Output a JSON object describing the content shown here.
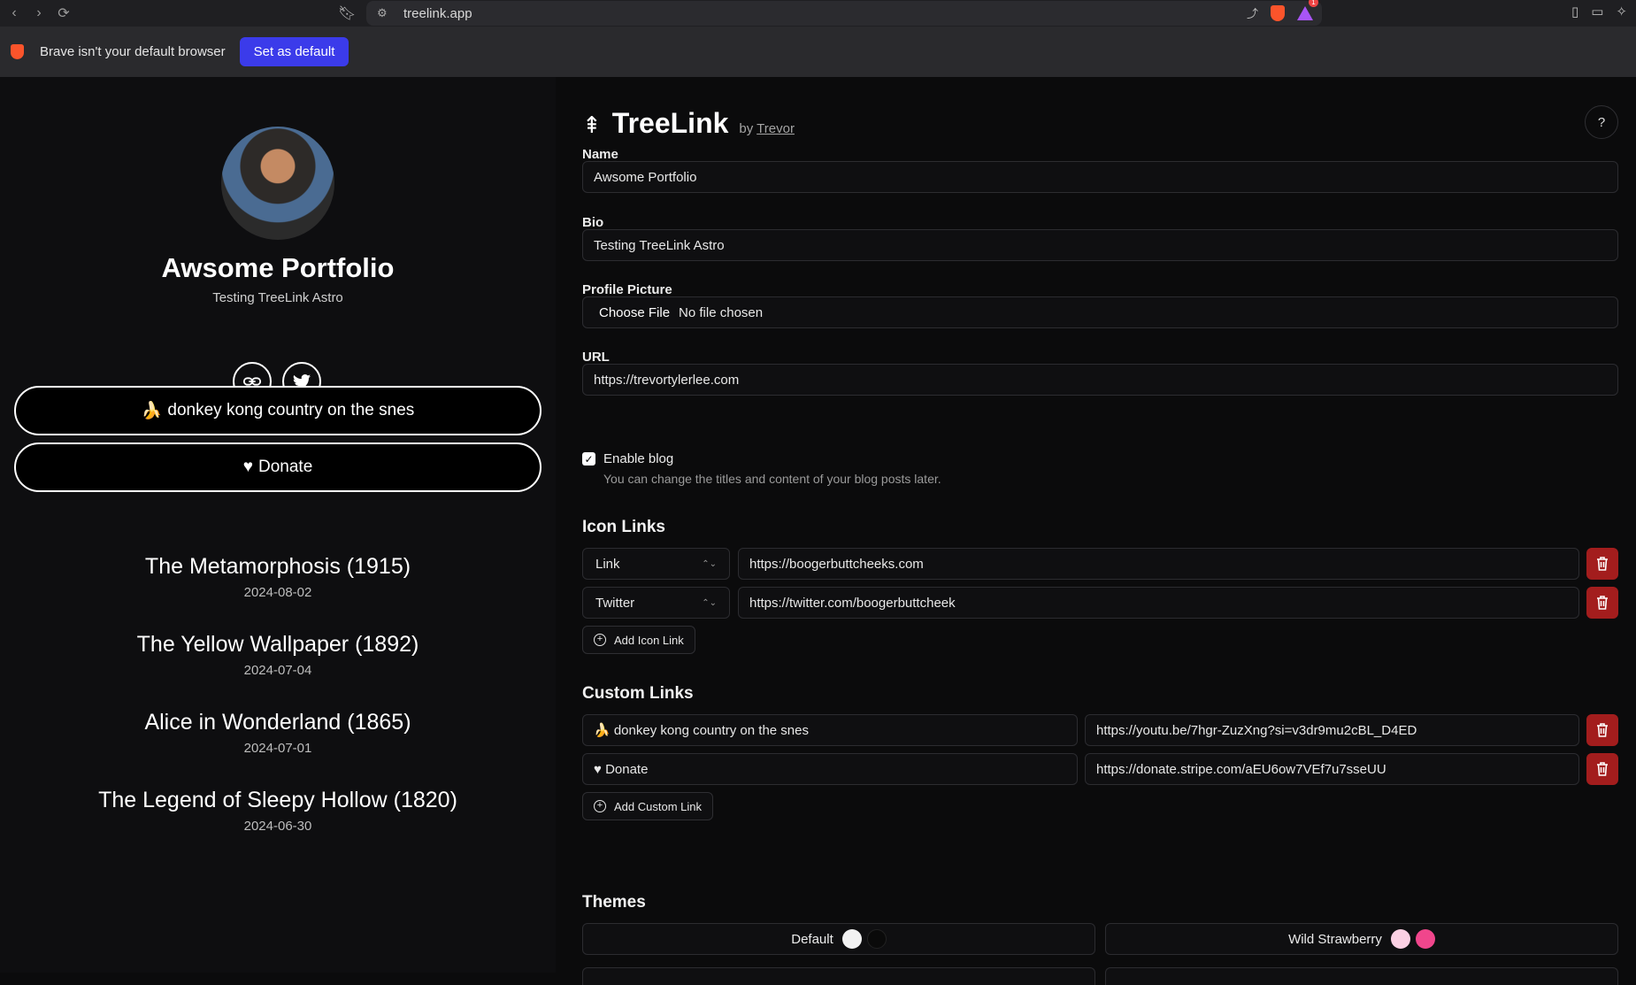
{
  "browser": {
    "url": "treelink.app",
    "infobar_message": "Brave isn't your default browser",
    "set_default_label": "Set as default",
    "notification_count": "1"
  },
  "preview": {
    "name": "Awsome Portfolio",
    "bio": "Testing TreeLink Astro",
    "social_icons": [
      "link-icon",
      "twitter-icon"
    ],
    "links": [
      {
        "emoji": "🍌",
        "label": "donkey kong country on the snes"
      },
      {
        "emoji": "♥",
        "label": "Donate"
      }
    ],
    "posts": [
      {
        "title": "The Metamorphosis (1915)",
        "date": "2024-08-02"
      },
      {
        "title": "The Yellow Wallpaper (1892)",
        "date": "2024-07-04"
      },
      {
        "title": "Alice in Wonderland (1865)",
        "date": "2024-07-01"
      },
      {
        "title": "The Legend of Sleepy Hollow (1820)",
        "date": "2024-06-30"
      }
    ]
  },
  "editor": {
    "brand_title": "TreeLink",
    "brand_by": "by",
    "brand_author": "Trevor",
    "help_label": "?",
    "name_label": "Name",
    "name_value": "Awsome Portfolio",
    "bio_label": "Bio",
    "bio_value": "Testing TreeLink Astro",
    "picture_label": "Profile Picture",
    "choose_file_label": "Choose File",
    "no_file_label": "No file chosen",
    "url_label": "URL",
    "url_value": "https://trevortylerlee.com",
    "enable_blog_label": "Enable blog",
    "enable_blog_checked": true,
    "enable_blog_hint": "You can change the titles and content of your blog posts later.",
    "icon_links_title": "Icon Links",
    "icon_links": [
      {
        "type": "Link",
        "url": "https://boogerbuttcheeks.com"
      },
      {
        "type": "Twitter",
        "url": "https://twitter.com/boogerbuttcheek"
      }
    ],
    "add_icon_link_label": "Add Icon Link",
    "custom_links_title": "Custom Links",
    "custom_links": [
      {
        "label": "🍌 donkey kong country on the snes",
        "url": "https://youtu.be/7hgr-ZuzXng?si=v3dr9mu2cBL_D4ED"
      },
      {
        "label": "♥ Donate",
        "url": "https://donate.stripe.com/aEU6ow7VEf7u7sseUU"
      }
    ],
    "add_custom_link_label": "Add Custom Link",
    "themes_title": "Themes",
    "themes": [
      {
        "name": "Default",
        "colors": [
          "#f2f2f2",
          "#0a0a0a"
        ]
      },
      {
        "name": "Wild Strawberry",
        "colors": [
          "#fbd0e3",
          "#f0468c"
        ]
      }
    ]
  },
  "colors": {
    "accent": "#3b3bea",
    "danger": "#a31d1d"
  }
}
